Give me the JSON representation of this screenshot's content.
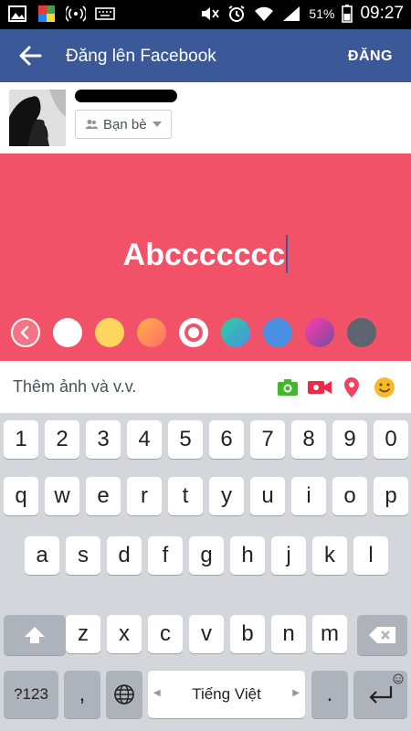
{
  "status_bar": {
    "battery": "51%",
    "time": "09:27"
  },
  "app_bar": {
    "title": "Đăng lên Facebook",
    "post_button": "ĐĂNG"
  },
  "post_header": {
    "audience": "Bạn bè"
  },
  "composer": {
    "text": "Abccccccc",
    "background_color": "#f25268",
    "swatch_colors": [
      "#ffffff",
      "#ffd45f",
      "#ff9a62",
      "#ffffff",
      "#3cc8a8",
      "#4a90e2",
      "#b93ce8",
      "#5d6470"
    ]
  },
  "add_bar": {
    "label": "Thêm ảnh và v.v."
  },
  "keyboard": {
    "row_numbers": [
      "1",
      "2",
      "3",
      "4",
      "5",
      "6",
      "7",
      "8",
      "9",
      "0"
    ],
    "row1": [
      "q",
      "w",
      "e",
      "r",
      "t",
      "y",
      "u",
      "i",
      "o",
      "p"
    ],
    "row2": [
      "a",
      "s",
      "d",
      "f",
      "g",
      "h",
      "j",
      "k",
      "l"
    ],
    "row3": [
      "z",
      "x",
      "c",
      "v",
      "b",
      "n",
      "m"
    ],
    "mode_key": "?123",
    "comma_key": ",",
    "space_label": "Tiếng Việt",
    "period_key": "."
  }
}
